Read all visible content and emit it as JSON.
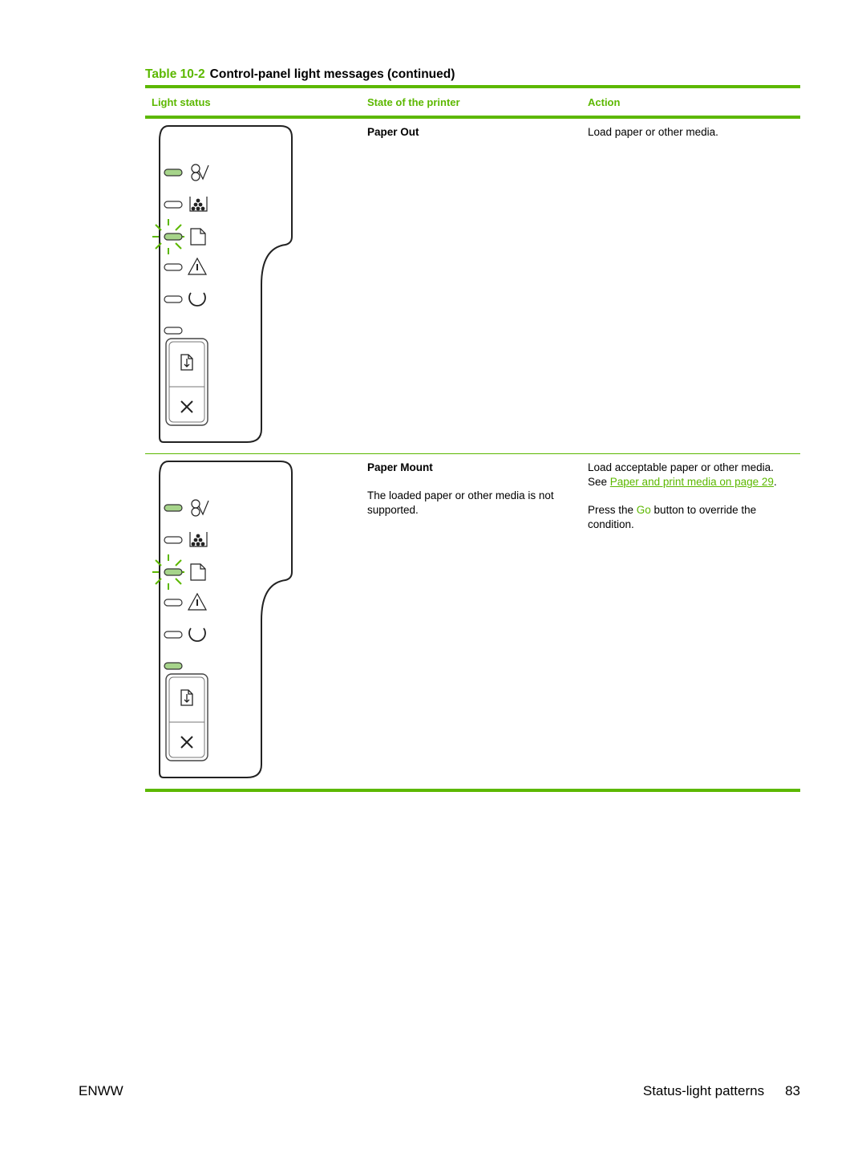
{
  "caption": {
    "number": "Table 10-2",
    "title": "Control-panel light messages (continued)"
  },
  "table": {
    "headers": [
      "Light status",
      "State of the printer",
      "Action"
    ],
    "rows": [
      {
        "state_title": "Paper Out",
        "state_detail": "",
        "action_lines": [
          "Load paper or other media."
        ],
        "lights": {
          "jam": "on",
          "toner": "off",
          "paper": "blinking",
          "attention": "off",
          "ready": "off",
          "go": "off"
        }
      },
      {
        "state_title": "Paper Mount",
        "state_detail": "The loaded paper or other media is not supported.",
        "action_line1": "Load acceptable paper or other media.",
        "action_see_prefix": "See ",
        "action_link": "Paper and print media on page 29",
        "action_see_suffix": ".",
        "action_press_prefix": "Press the ",
        "action_go": "Go",
        "action_press_suffix": " button to override the condition.",
        "lights": {
          "jam": "on",
          "toner": "off",
          "paper": "blinking",
          "attention": "off",
          "ready": "off",
          "go": "on"
        }
      }
    ]
  },
  "colors": {
    "accent": "#5cb800",
    "light_on": "#a6d48a"
  },
  "footer": {
    "left": "ENWW",
    "section": "Status-light patterns",
    "page": "83"
  }
}
